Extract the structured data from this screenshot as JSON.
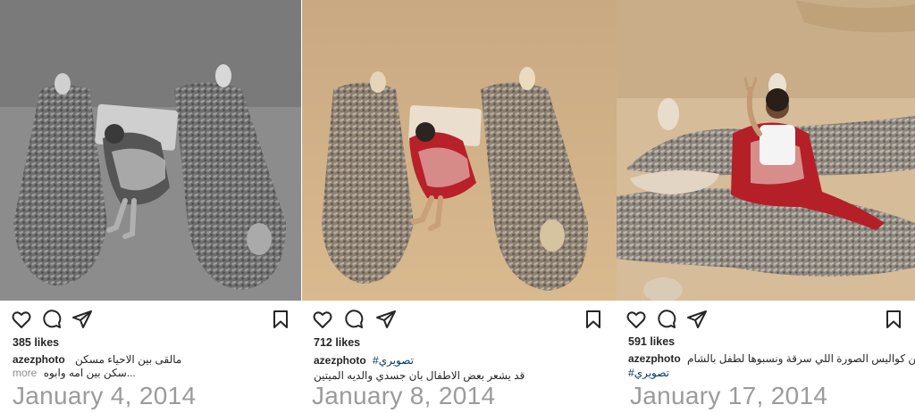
{
  "posts": [
    {
      "likes": "385 likes",
      "username": "azezphoto",
      "caption_line1": "مالقى بين الاحياء مسكن",
      "caption_line2": "سكن بين امه وابوه...",
      "more": "more",
      "date": "January 4, 2014"
    },
    {
      "likes": "712 likes",
      "username": "azezphoto",
      "hashtag": "#تصويري",
      "caption_line2": "قد يشعر بعض الاطفال بان جسدي والديه الميتين",
      "date": "January 8, 2014"
    },
    {
      "likes": "591 likes",
      "username": "azezphoto",
      "caption_line1": "من كواليس الصورة اللي سرقة  ونسبوها لطفل بالشام",
      "hashtag": "#تصويري",
      "date": "January 17, 2014"
    }
  ],
  "icons": [
    "heart-icon",
    "comment-icon",
    "share-icon",
    "bookmark-icon"
  ],
  "colors": {
    "text": "#262626",
    "hashtag": "#00376b",
    "date": "#9b9b9b"
  }
}
